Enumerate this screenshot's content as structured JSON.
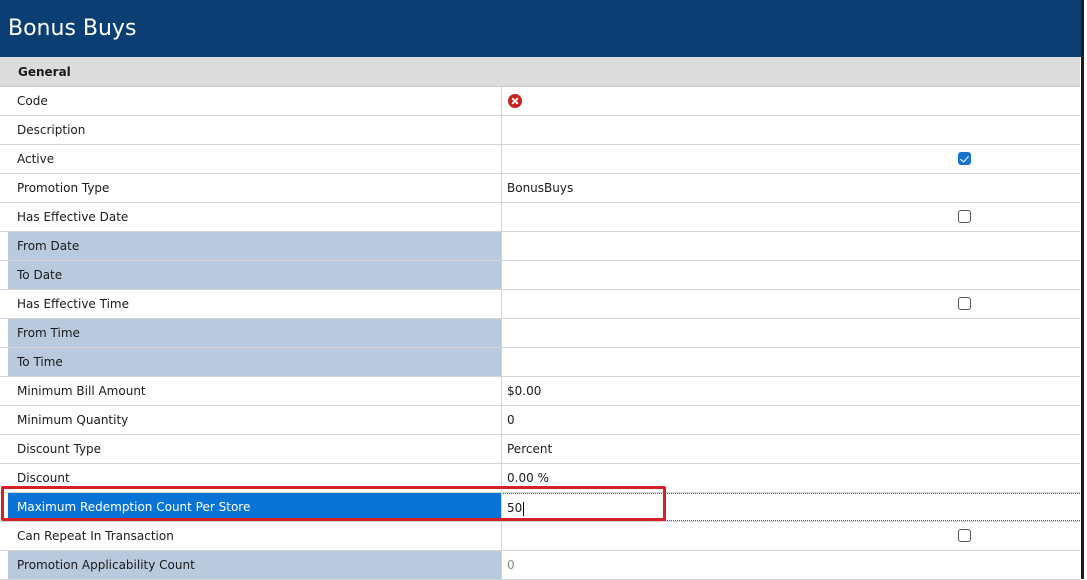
{
  "title": "Bonus Buys",
  "section": "General",
  "rows": {
    "code": {
      "label": "Code"
    },
    "description": {
      "label": "Description",
      "value": ""
    },
    "active": {
      "label": "Active"
    },
    "promotion_type": {
      "label": "Promotion Type",
      "value": "BonusBuys"
    },
    "has_effective_date": {
      "label": "Has Effective Date"
    },
    "from_date": {
      "label": "From Date",
      "value": ""
    },
    "to_date": {
      "label": "To Date",
      "value": ""
    },
    "has_effective_time": {
      "label": "Has Effective Time"
    },
    "from_time": {
      "label": "From Time",
      "value": ""
    },
    "to_time": {
      "label": "To Time",
      "value": ""
    },
    "minimum_bill_amount": {
      "label": "Minimum Bill Amount",
      "value": "$0.00"
    },
    "minimum_quantity": {
      "label": "Minimum Quantity",
      "value": "0"
    },
    "discount_type": {
      "label": "Discount Type",
      "value": "Percent"
    },
    "discount": {
      "label": "Discount",
      "value": "0.00 %"
    },
    "max_redemption": {
      "label": "Maximum Redemption Count Per Store",
      "value": "50"
    },
    "can_repeat": {
      "label": "Can Repeat In Transaction"
    },
    "applicability_count": {
      "label": "Promotion Applicability Count",
      "value": "0"
    }
  },
  "states": {
    "active_checked": true,
    "has_effective_date_checked": false,
    "has_effective_time_checked": false,
    "can_repeat_checked": false
  },
  "colors": {
    "header_bg": "#0b3f74",
    "disabled_label_bg": "#b9c9de",
    "selected_label_bg": "#0a74d6",
    "highlight_border": "#d61f26",
    "error_icon": "#cc1f1f",
    "checkbox_checked": "#1673d1"
  },
  "icons": {
    "code_status": "error-circle-x-icon"
  }
}
